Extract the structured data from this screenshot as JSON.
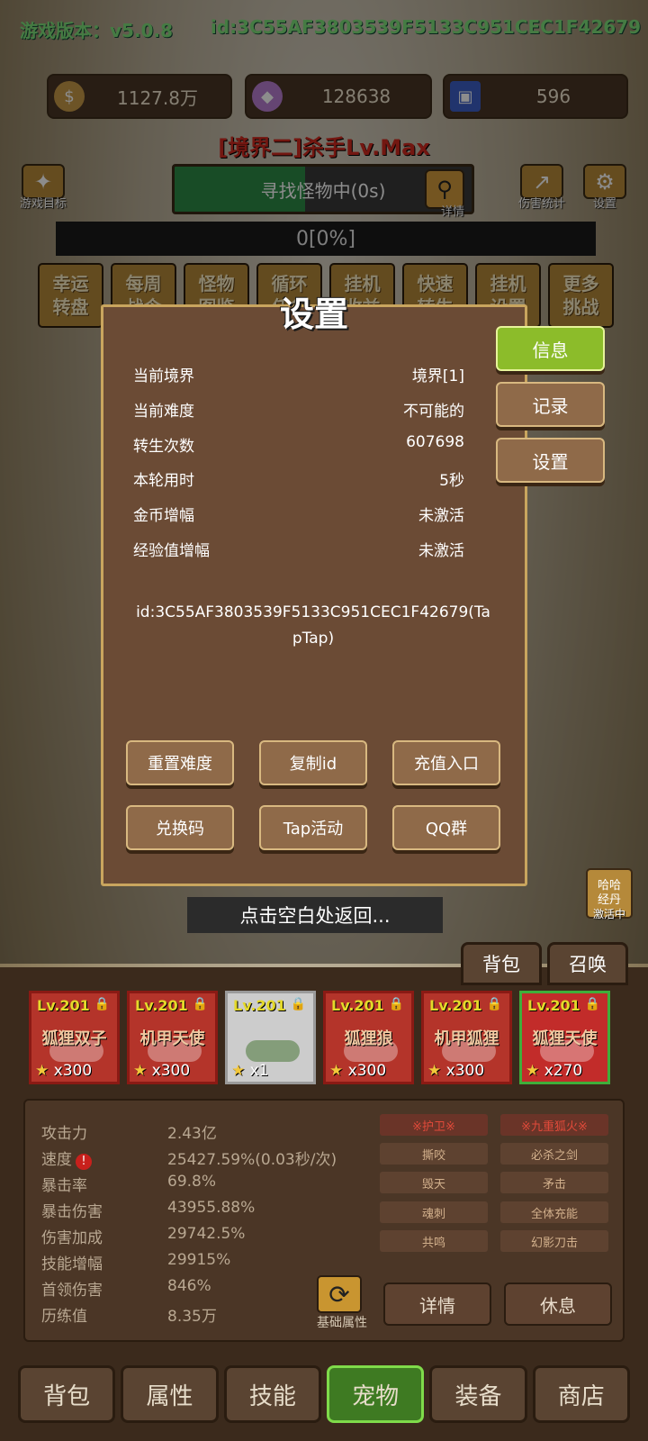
{
  "header": {
    "version_label": "游戏版本：v5.0.8",
    "player_id": "id:3C55AF3803539F5133C951CEC1F42679"
  },
  "resources": [
    {
      "icon": "coin-icon",
      "value": "1127.8万",
      "color": "#c79a47"
    },
    {
      "icon": "crystal-icon",
      "value": "128638",
      "color": "#b97fd1"
    },
    {
      "icon": "card-icon",
      "value": "596",
      "color": "#3d5fc7"
    }
  ],
  "stage_title": "[境界二]杀手Lv.Max",
  "top_buttons": {
    "game_goal": "游戏目标",
    "details": "详情",
    "damage_stats": "伤害统计",
    "settings": "设置"
  },
  "search_status": "寻找怪物中(0s)",
  "progress_text": "0[0%]",
  "menu_items": [
    "幸运\n转盘",
    "每周\n战令",
    "怪物\n图鉴",
    "循环\n任务",
    "挂机\n收益",
    "快速\n转生",
    "挂机\n设置",
    "更多\n挑战"
  ],
  "dialog": {
    "title": "设置",
    "rows": [
      {
        "label": "当前境界",
        "value": "境界[1]"
      },
      {
        "label": "当前难度",
        "value": "不可能的"
      },
      {
        "label": "转生次数",
        "value": "607698"
      },
      {
        "label": "本轮用时",
        "value": "5秒"
      },
      {
        "label": "金币增幅",
        "value": "未激活"
      },
      {
        "label": "经验值增幅",
        "value": "未激活"
      }
    ],
    "id_text_line1": "id:3C55AF3803539F5133C951CEC1F42679(Ta",
    "id_text_line2": "pTap)",
    "buttons": [
      "重置难度",
      "复制id",
      "充值入口",
      "兑换码",
      "Tap活动",
      "QQ群"
    ],
    "side_tabs": [
      "信息",
      "记录",
      "设置"
    ],
    "active_side_tab": "信息"
  },
  "back_hint": "点击空白处返回...",
  "bonus": {
    "label": "哈哈\n经丹",
    "status": "激活中"
  },
  "panel_tabs": [
    "背包",
    "召唤"
  ],
  "pets": [
    {
      "level": "Lv.201",
      "name": "狐狸双子",
      "stars": "x300",
      "frame": "red"
    },
    {
      "level": "Lv.201",
      "name": "机甲天使",
      "stars": "x300",
      "frame": "red"
    },
    {
      "level": "Lv.201",
      "name": "",
      "stars": "x1",
      "frame": "white"
    },
    {
      "level": "Lv.201",
      "name": "狐狸狼",
      "stars": "x300",
      "frame": "red"
    },
    {
      "level": "Lv.201",
      "name": "机甲狐狸",
      "stars": "x300",
      "frame": "red"
    },
    {
      "level": "Lv.201",
      "name": "狐狸天使",
      "stars": "x270",
      "frame": "green"
    }
  ],
  "stats": [
    {
      "label": "攻击力",
      "value": "2.43亿"
    },
    {
      "label": "速度",
      "value": "25427.59%(0.03秒/次)"
    },
    {
      "label": "暴击率",
      "value": "69.8%"
    },
    {
      "label": "暴击伤害",
      "value": "43955.88%"
    },
    {
      "label": "伤害加成",
      "value": "29742.5%"
    },
    {
      "label": "技能增幅",
      "value": "29915%"
    },
    {
      "label": "首领伤害",
      "value": "846%"
    },
    {
      "label": "历练值",
      "value": "8.35万"
    }
  ],
  "skills": [
    "※护卫※",
    "※九重狐火※",
    "撕咬",
    "必杀之剑",
    "毁天",
    "矛击",
    "魂刺",
    "全体充能",
    "共鸣",
    "幻影刀击"
  ],
  "base_attr_label": "基础属性",
  "detail_btn": "详情",
  "rest_btn": "休息",
  "nav": [
    "背包",
    "属性",
    "技能",
    "宠物",
    "装备",
    "商店"
  ],
  "active_nav": "宠物"
}
